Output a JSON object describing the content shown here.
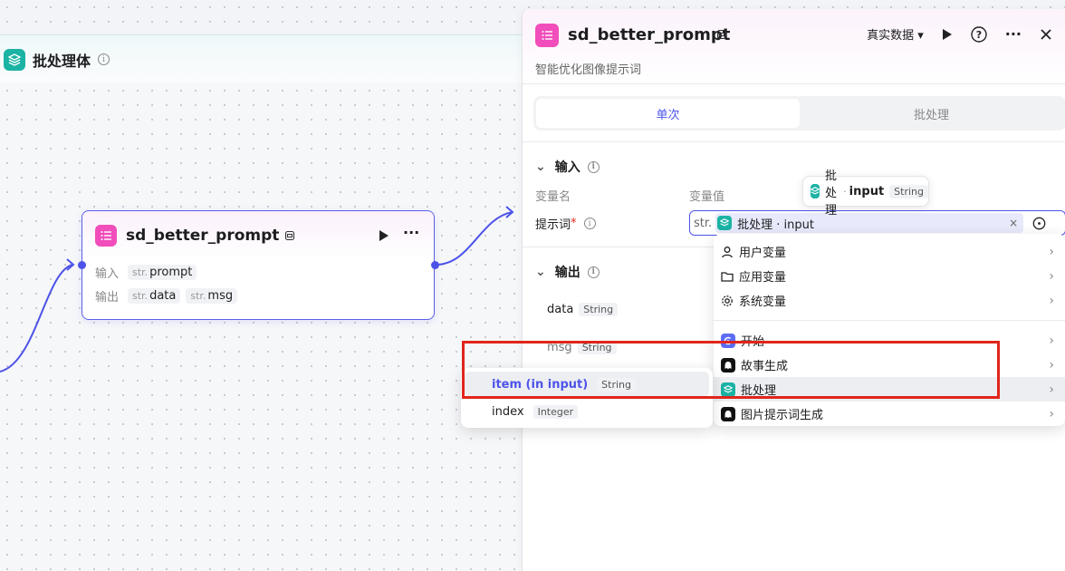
{
  "group": {
    "title": "批处理体"
  },
  "node": {
    "title": "sd_better_prompt",
    "input_label": "输入",
    "output_label": "输出",
    "input_chip_type": "str.",
    "input_chip_name": "prompt",
    "output_chips": [
      {
        "type": "str.",
        "name": "data"
      },
      {
        "type": "str.",
        "name": "msg"
      }
    ]
  },
  "panel": {
    "title": "sd_better_prompt",
    "description": "智能优化图像提示词",
    "data_mode": "真实数据",
    "tabs": [
      "单次",
      "批处理"
    ],
    "input_section": "输入",
    "col_var_name": "变量名",
    "col_var_value": "变量值",
    "field_label": "提示词",
    "required_mark": "*",
    "value_prefix": "str.",
    "value_ref": "批处理 · input",
    "output_section": "输出",
    "outputs": [
      {
        "name": "data",
        "type": "String"
      },
      {
        "name": "msg",
        "type": "String"
      }
    ]
  },
  "tooltip": {
    "source": "批处理",
    "sep": "·",
    "var": "input",
    "type": "String"
  },
  "dropdown": {
    "items": [
      {
        "label": "用户变量",
        "icon": "user-icon"
      },
      {
        "label": "应用变量",
        "icon": "folder-icon"
      },
      {
        "label": "系统变量",
        "icon": "gear-icon"
      },
      {
        "label": "开始",
        "icon": "start-icon"
      },
      {
        "label": "故事生成",
        "icon": "bot-icon"
      },
      {
        "label": "批处理",
        "icon": "layers-icon"
      },
      {
        "label": "图片提示词生成",
        "icon": "bot-icon"
      }
    ]
  },
  "submenu": {
    "items": [
      {
        "name": "item (in input)",
        "type": "String"
      },
      {
        "name": "index",
        "type": "Integer"
      }
    ]
  },
  "colors": {
    "accent": "#4d53e8",
    "highlight": "#e1251b",
    "teal": "#1bb3a4",
    "pink": "#f14dbb"
  }
}
